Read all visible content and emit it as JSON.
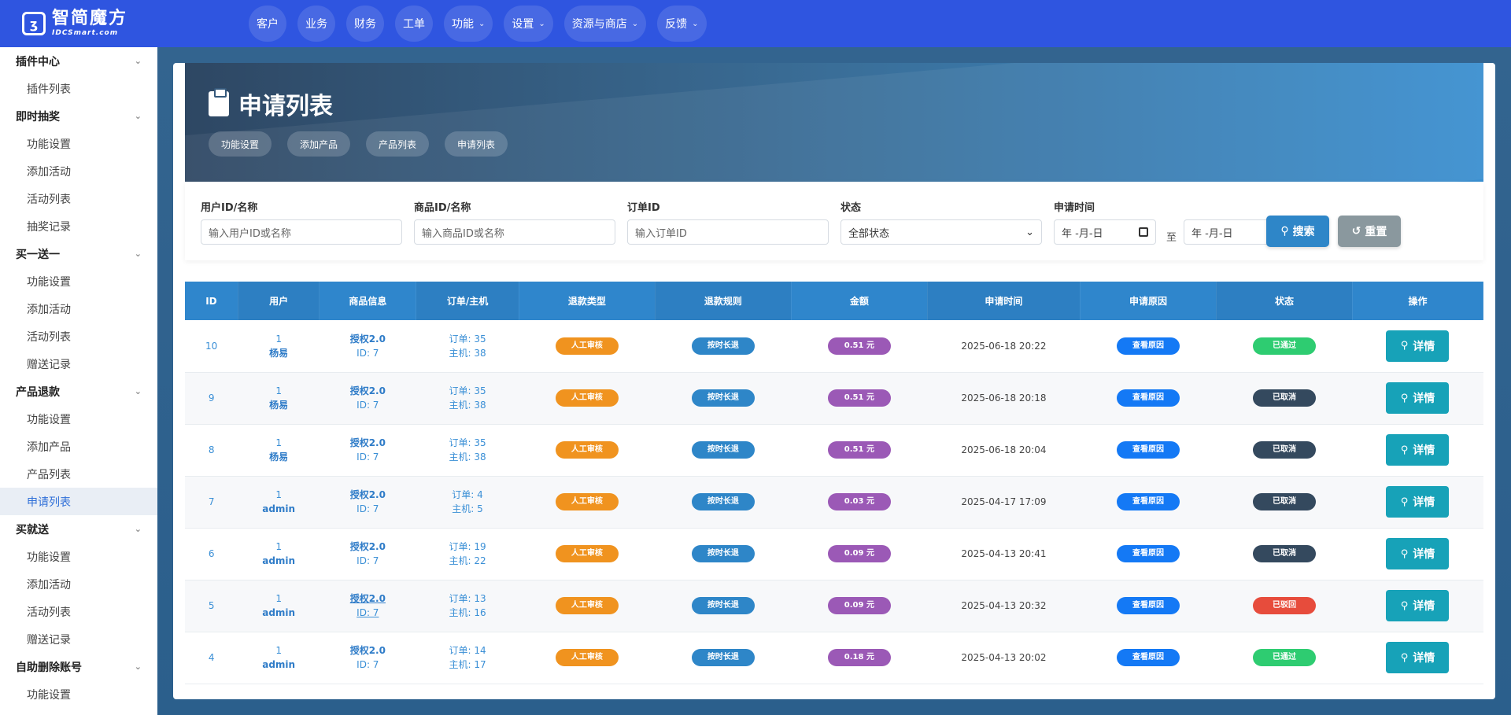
{
  "brand": {
    "cn": "智简魔方",
    "en": "IDCSmart.com"
  },
  "topnav": [
    {
      "label": "客户",
      "has_dropdown": false
    },
    {
      "label": "业务",
      "has_dropdown": false
    },
    {
      "label": "财务",
      "has_dropdown": false
    },
    {
      "label": "工单",
      "has_dropdown": false
    },
    {
      "label": "功能",
      "has_dropdown": true
    },
    {
      "label": "设置",
      "has_dropdown": true
    },
    {
      "label": "资源与商店",
      "has_dropdown": true
    },
    {
      "label": "反馈",
      "has_dropdown": true
    }
  ],
  "sidebar": [
    {
      "group": "插件中心",
      "items": [
        "插件列表"
      ]
    },
    {
      "group": "即时抽奖",
      "items": [
        "功能设置",
        "添加活动",
        "活动列表",
        "抽奖记录"
      ]
    },
    {
      "group": "买一送一",
      "items": [
        "功能设置",
        "添加活动",
        "活动列表",
        "赠送记录"
      ]
    },
    {
      "group": "产品退款",
      "items": [
        "功能设置",
        "添加产品",
        "产品列表",
        "申请列表"
      ]
    },
    {
      "group": "买就送",
      "items": [
        "功能设置",
        "添加活动",
        "活动列表",
        "赠送记录"
      ]
    },
    {
      "group": "自助删除账号",
      "items": [
        "功能设置"
      ]
    }
  ],
  "sidebar_active": "申请列表",
  "page": {
    "title": "申请列表",
    "tabs": [
      "功能设置",
      "添加产品",
      "产品列表",
      "申请列表"
    ]
  },
  "filter": {
    "user_label": "用户ID/名称",
    "user_placeholder": "输入用户ID或名称",
    "product_label": "商品ID/名称",
    "product_placeholder": "输入商品ID或名称",
    "order_label": "订单ID",
    "order_placeholder": "输入订单ID",
    "status_label": "状态",
    "status_value": "全部状态",
    "time_label": "申请时间",
    "date_placeholder": "年 -月-日",
    "to": "至",
    "search_label": "搜索",
    "reset_label": "重置"
  },
  "table": {
    "headers": [
      "ID",
      "用户",
      "商品信息",
      "订单/主机",
      "退款类型",
      "退款规则",
      "金额",
      "申请时间",
      "申请原因",
      "状态",
      "操作"
    ],
    "reason_label": "查看原因",
    "detail_label": "详情",
    "rows": [
      {
        "id": "10",
        "uid": "1",
        "uname": "杨易",
        "pname": "授权2.0",
        "pid": "ID: 7",
        "order": "订单: 35",
        "host": "主机: 38",
        "type": "人工审核",
        "rule": "按时长退",
        "amount": "0.51 元",
        "time": "2025-06-18 20:22",
        "status": "已通过",
        "status_color": "green",
        "underline": false
      },
      {
        "id": "9",
        "uid": "1",
        "uname": "杨易",
        "pname": "授权2.0",
        "pid": "ID: 7",
        "order": "订单: 35",
        "host": "主机: 38",
        "type": "人工审核",
        "rule": "按时长退",
        "amount": "0.51 元",
        "time": "2025-06-18 20:18",
        "status": "已取消",
        "status_color": "dark",
        "underline": false
      },
      {
        "id": "8",
        "uid": "1",
        "uname": "杨易",
        "pname": "授权2.0",
        "pid": "ID: 7",
        "order": "订单: 35",
        "host": "主机: 38",
        "type": "人工审核",
        "rule": "按时长退",
        "amount": "0.51 元",
        "time": "2025-06-18 20:04",
        "status": "已取消",
        "status_color": "dark",
        "underline": false
      },
      {
        "id": "7",
        "uid": "1",
        "uname": "admin",
        "pname": "授权2.0",
        "pid": "ID: 7",
        "order": "订单: 4",
        "host": "主机: 5",
        "type": "人工审核",
        "rule": "按时长退",
        "amount": "0.03 元",
        "time": "2025-04-17 17:09",
        "status": "已取消",
        "status_color": "dark",
        "underline": false
      },
      {
        "id": "6",
        "uid": "1",
        "uname": "admin",
        "pname": "授权2.0",
        "pid": "ID: 7",
        "order": "订单: 19",
        "host": "主机: 22",
        "type": "人工审核",
        "rule": "按时长退",
        "amount": "0.09 元",
        "time": "2025-04-13 20:41",
        "status": "已取消",
        "status_color": "dark",
        "underline": false
      },
      {
        "id": "5",
        "uid": "1",
        "uname": "admin",
        "pname": "授权2.0",
        "pid": "ID: 7",
        "order": "订单: 13",
        "host": "主机: 16",
        "type": "人工审核",
        "rule": "按时长退",
        "amount": "0.09 元",
        "time": "2025-04-13 20:32",
        "status": "已驳回",
        "status_color": "red",
        "underline": true
      },
      {
        "id": "4",
        "uid": "1",
        "uname": "admin",
        "pname": "授权2.0",
        "pid": "ID: 7",
        "order": "订单: 14",
        "host": "主机: 17",
        "type": "人工审核",
        "rule": "按时长退",
        "amount": "0.18 元",
        "time": "2025-04-13 20:02",
        "status": "已通过",
        "status_color": "green",
        "underline": false
      }
    ]
  },
  "colors": {
    "topbar": "#2f55e0",
    "accent": "#2e86c8",
    "detail": "#17a2b8"
  }
}
